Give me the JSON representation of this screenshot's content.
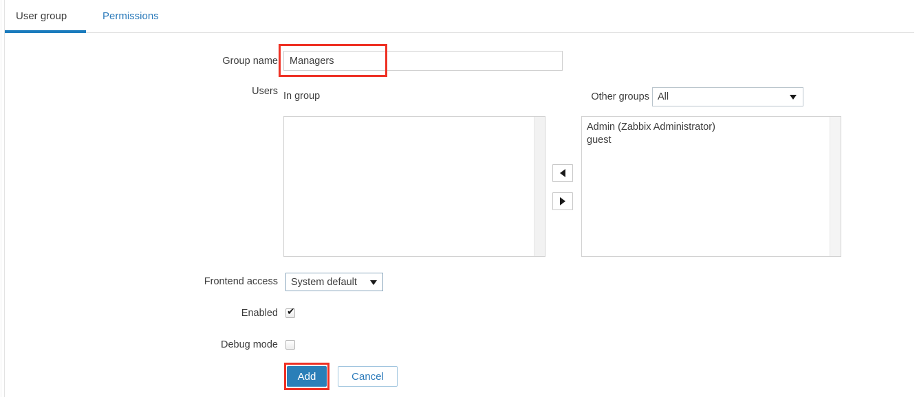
{
  "tabs": [
    {
      "label": "User group",
      "active": true
    },
    {
      "label": "Permissions",
      "active": false
    }
  ],
  "form": {
    "group_name": {
      "label": "Group name",
      "value": "Managers",
      "placeholder": ""
    },
    "users": {
      "label": "Users",
      "in_group_label": "In group",
      "in_group_items": [],
      "other_groups_label": "Other groups",
      "other_groups_selected": "All",
      "other_groups_options": [
        "All"
      ],
      "other_groups_items": [
        "Admin (Zabbix Administrator)",
        "guest"
      ],
      "move_left_icon": "triangle-left-icon",
      "move_right_icon": "triangle-right-icon"
    },
    "frontend_access": {
      "label": "Frontend access",
      "selected": "System default",
      "options": [
        "System default"
      ]
    },
    "enabled": {
      "label": "Enabled",
      "checked": true,
      "mark": "✔"
    },
    "debug_mode": {
      "label": "Debug mode",
      "checked": false,
      "mark": ""
    }
  },
  "actions": {
    "add_label": "Add",
    "cancel_label": "Cancel"
  },
  "colors": {
    "accent_blue": "#2a7fb8",
    "tab_active_underline": "#1a7bbd",
    "link_blue": "#2b7aba",
    "annotation_red": "#ee3124",
    "text": "#3c3c3c"
  },
  "annotations": [
    {
      "name": "group-name-highlight"
    },
    {
      "name": "add-button-highlight"
    }
  ]
}
